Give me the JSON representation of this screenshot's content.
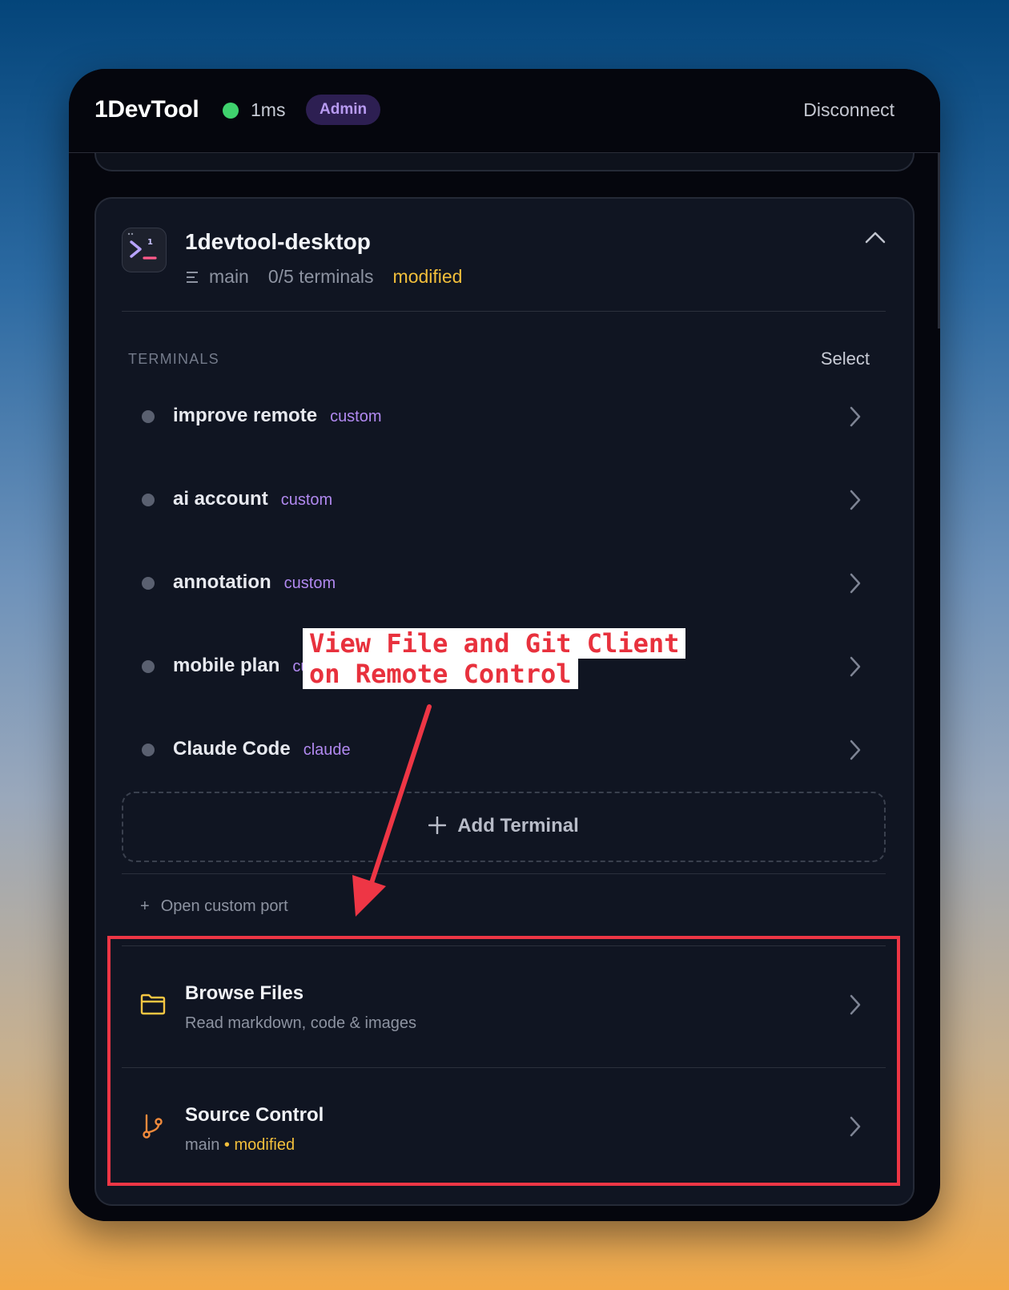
{
  "header": {
    "app_title": "1DevTool",
    "latency": "1ms",
    "role_badge": "Admin",
    "disconnect_label": "Disconnect",
    "status_color": "#3fd26d"
  },
  "project": {
    "name": "1devtool-desktop",
    "icon": "terminal-prompt-icon",
    "branch": "main",
    "terminal_count": "0/5 terminals",
    "status": "modified"
  },
  "terminals": {
    "section_label": "TERMINALS",
    "select_label": "Select",
    "items": [
      {
        "name": "improve remote",
        "tag": "custom"
      },
      {
        "name": "ai account",
        "tag": "custom"
      },
      {
        "name": "annotation",
        "tag": "custom"
      },
      {
        "name": "mobile plan",
        "tag": "custom"
      },
      {
        "name": "Claude Code",
        "tag": "claude"
      }
    ],
    "add_label": "Add Terminal"
  },
  "custom_port": {
    "label": "Open custom port"
  },
  "tools": {
    "browse": {
      "title": "Browse Files",
      "subtitle": "Read markdown, code & images"
    },
    "source_control": {
      "title": "Source Control",
      "branch": "main",
      "separator": "•",
      "status": "modified"
    }
  },
  "annotation": {
    "line1": "View File and Git Client",
    "line2": "on Remote Control",
    "color": "#e8313d"
  },
  "colors": {
    "accent_purple": "#b189f0",
    "modified_yellow": "#f3bf3b",
    "folder_yellow": "#f5c542",
    "git_orange": "#f08a3c"
  }
}
